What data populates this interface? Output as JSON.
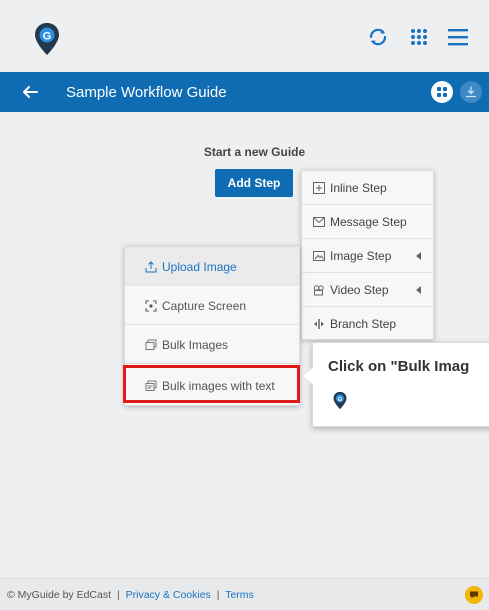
{
  "colors": {
    "primary": "#0f6cb3",
    "highlight": "#e11a1a",
    "chat": "#f2b705"
  },
  "topbar": {
    "icons": [
      "myguide-logo-icon",
      "refresh-icon",
      "apps-grid-icon",
      "hamburger-menu-icon"
    ]
  },
  "header": {
    "title": "Sample Workflow Guide",
    "icons": [
      "back-arrow-icon",
      "apps-icon",
      "download-icon"
    ]
  },
  "main": {
    "start_title": "Start a new Guide",
    "add_step_label": "Add Step"
  },
  "step_menu": {
    "items": [
      {
        "label": "Inline Step",
        "icon": "plus-square-icon"
      },
      {
        "label": "Message Step",
        "icon": "message-icon"
      },
      {
        "label": "Image Step",
        "icon": "image-icon"
      },
      {
        "label": "Video Step",
        "icon": "video-icon"
      },
      {
        "label": "Branch Step",
        "icon": "branch-icon"
      }
    ]
  },
  "upload_menu": {
    "items": [
      {
        "label": "Upload Image",
        "icon": "upload-icon"
      },
      {
        "label": "Capture Screen",
        "icon": "capture-icon"
      },
      {
        "label": "Bulk Images",
        "icon": "bulk-images-icon"
      },
      {
        "label": "Bulk images with text",
        "icon": "bulk-images-text-icon"
      }
    ]
  },
  "tooltip": {
    "text": "Click on \"Bulk Imag"
  },
  "footer": {
    "copyright": "© MyGuide by EdCast",
    "separator": "|",
    "privacy_label": "Privacy & Cookies",
    "terms_label": "Terms"
  }
}
